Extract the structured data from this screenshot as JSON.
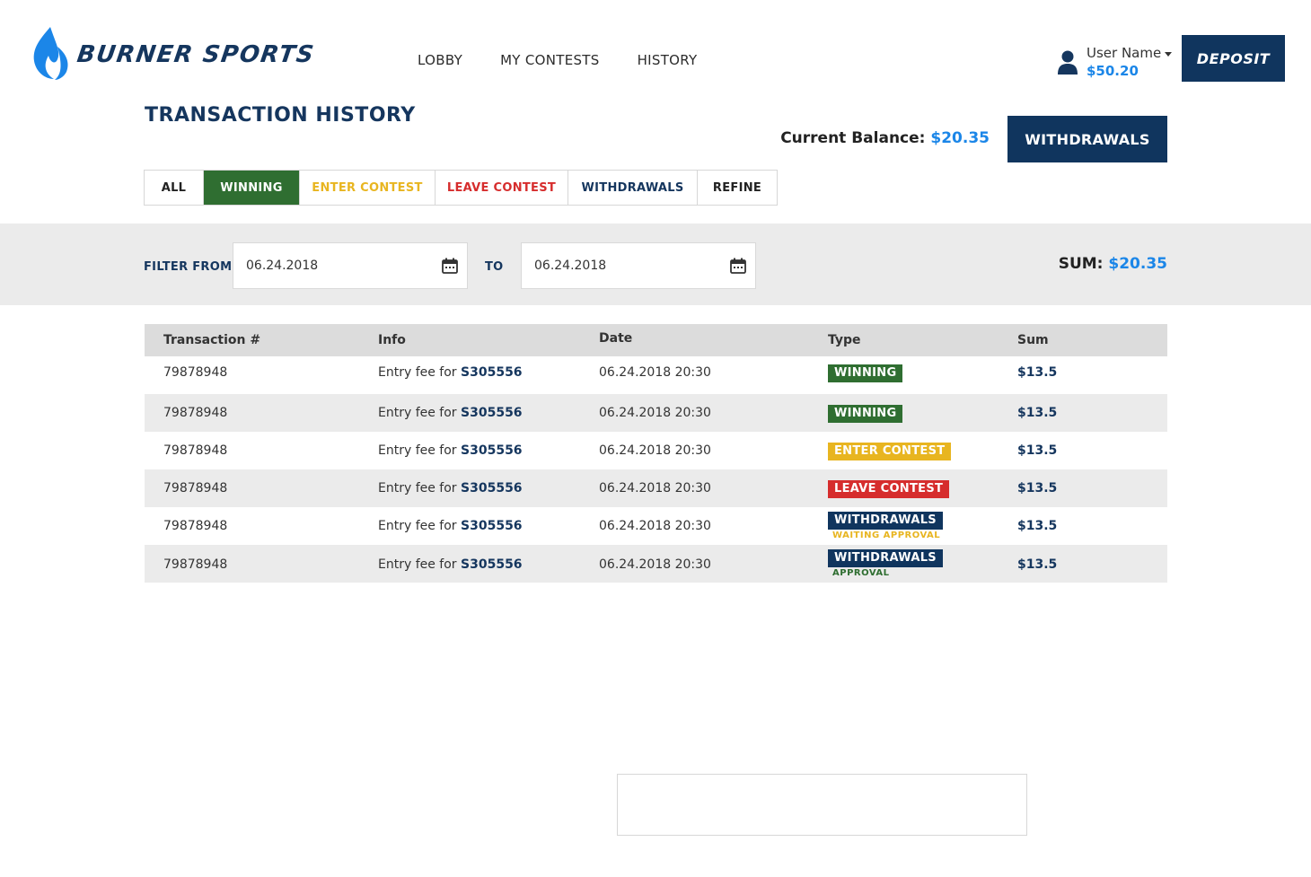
{
  "brand": {
    "name": "BURNER SPORTS",
    "color": "#15365e",
    "flame_color": "#1b86e8"
  },
  "nav": [
    "LOBBY",
    "MY CONTESTS",
    "HISTORY"
  ],
  "user": {
    "name": "User Name",
    "balance": "$50.20"
  },
  "deposit_label": "DEPOSIT",
  "page_title": "TRANSACTION HISTORY",
  "current_balance": {
    "label": "Current Balance:",
    "value": "$20.35"
  },
  "withdrawals_button": "WITHDRAWALS",
  "tabs": [
    {
      "label": "ALL",
      "active": false
    },
    {
      "label": "WINNING",
      "active": true
    },
    {
      "label": "ENTER CONTEST",
      "active": false
    },
    {
      "label": "LEAVE CONTEST",
      "active": false
    },
    {
      "label": "WITHDRAWALS",
      "active": false
    },
    {
      "label": "REFINE",
      "active": false
    }
  ],
  "filter": {
    "from_label": "FILTER FROM",
    "from_value": "06.24.2018",
    "to_label": "TO",
    "to_value": "06.24.2018",
    "sum_label": "SUM:",
    "sum_value": "$20.35"
  },
  "table": {
    "headers": [
      "Transaction #",
      "Info",
      "Date",
      "Type",
      "Sum"
    ],
    "rows": [
      {
        "id": "79878948",
        "info_prefix": "Entry fee for",
        "info_id": "S305556",
        "date": "06.24.2018 20:30",
        "type": "WINNING",
        "status": "",
        "sum": "$13.5"
      },
      {
        "id": "79878948",
        "info_prefix": "Entry fee for",
        "info_id": "S305556",
        "date": "06.24.2018 20:30",
        "type": "WINNING",
        "status": "",
        "sum": "$13.5"
      },
      {
        "id": "79878948",
        "info_prefix": "Entry fee for",
        "info_id": "S305556",
        "date": "06.24.2018 20:30",
        "type": "ENTER CONTEST",
        "status": "",
        "sum": "$13.5"
      },
      {
        "id": "79878948",
        "info_prefix": "Entry fee for",
        "info_id": "S305556",
        "date": "06.24.2018 20:30",
        "type": "LEAVE CONTEST",
        "status": "",
        "sum": "$13.5"
      },
      {
        "id": "79878948",
        "info_prefix": "Entry fee for",
        "info_id": "S305556",
        "date": "06.24.2018 20:30",
        "type": "WITHDRAWALS",
        "status": "WAITING APPROVAL",
        "sum": "$13.5"
      },
      {
        "id": "79878948",
        "info_prefix": "Entry fee for",
        "info_id": "S305556",
        "date": "06.24.2018 20:30",
        "type": "WITHDRAWALS",
        "status": "APPROVAL",
        "sum": "$13.5"
      }
    ]
  },
  "colors": {
    "navy": "#10355e",
    "blue": "#1b86e8",
    "green": "#2f6e31",
    "yellow": "#e8b520",
    "red": "#d62d2d"
  }
}
